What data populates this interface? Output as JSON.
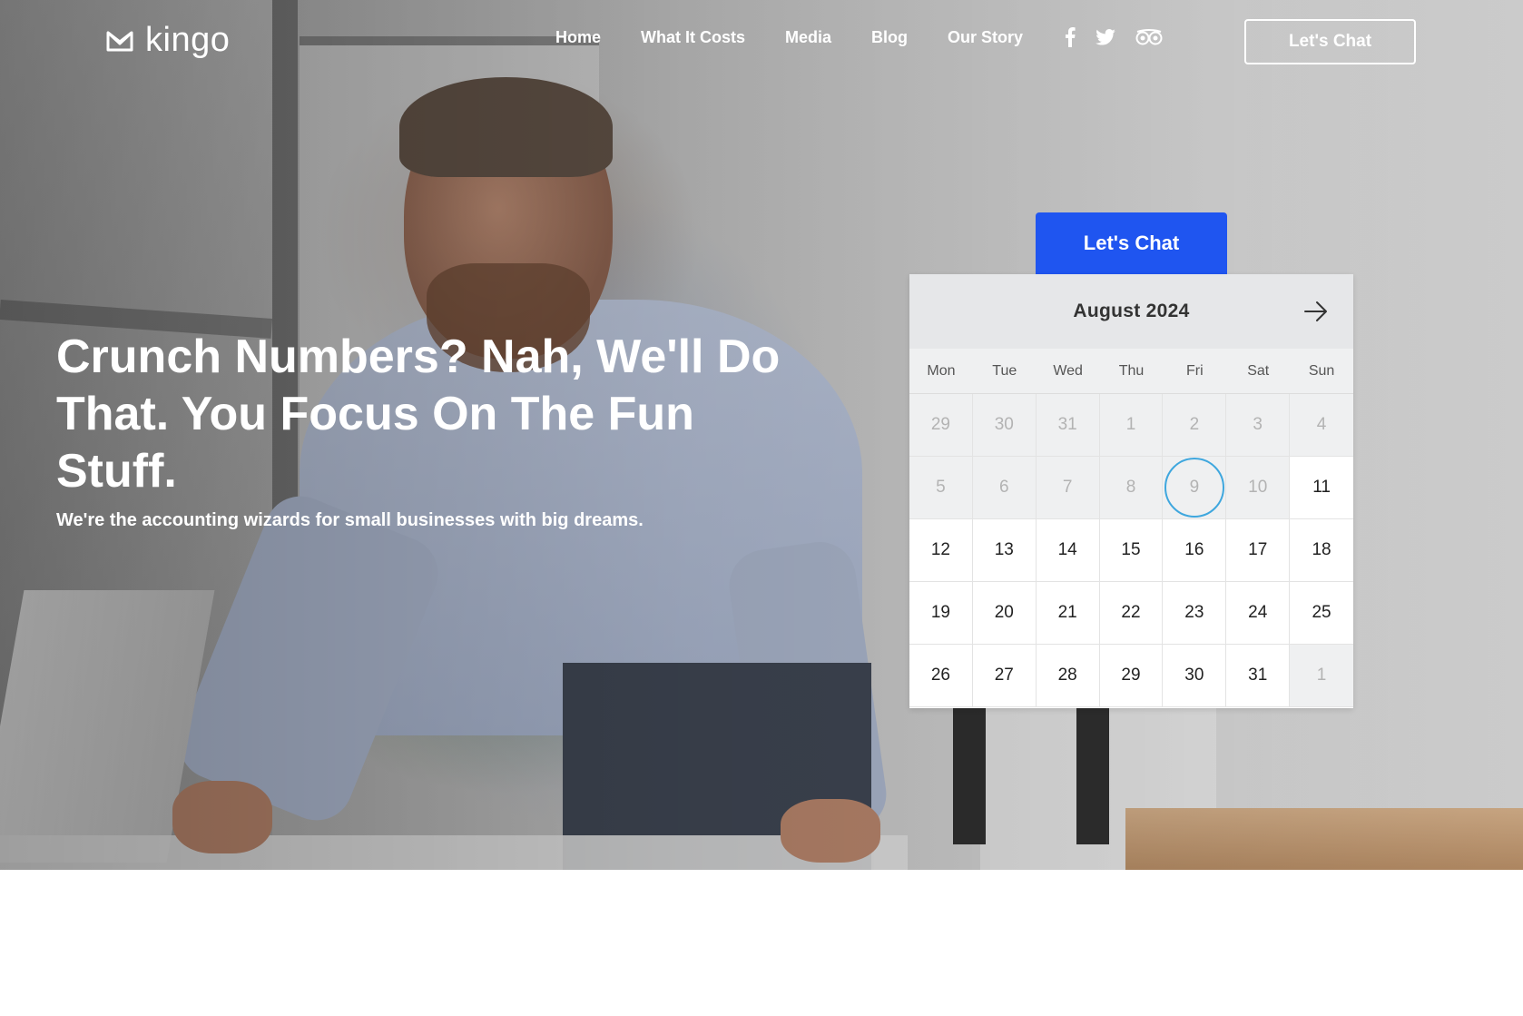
{
  "header": {
    "logo_text": "kingo",
    "nav": [
      "Home",
      "What It Costs",
      "Media",
      "Blog",
      "Our Story"
    ],
    "social_icons": [
      "facebook-icon",
      "twitter-icon",
      "tripadvisor-icon"
    ],
    "cta_label": "Let's Chat"
  },
  "hero": {
    "headline": "Crunch Numbers? Nah, We'll Do That. You Focus On The Fun Stuff.",
    "subline": "We're the accounting wizards for small businesses with big dreams."
  },
  "scheduler": {
    "tab_label": "Let's Chat",
    "month_label": "August 2024",
    "weekdays": [
      "Mon",
      "Tue",
      "Wed",
      "Thu",
      "Fri",
      "Sat",
      "Sun"
    ],
    "days": [
      {
        "label": "29",
        "state": "inactive"
      },
      {
        "label": "30",
        "state": "inactive"
      },
      {
        "label": "31",
        "state": "inactive"
      },
      {
        "label": "1",
        "state": "inactive"
      },
      {
        "label": "2",
        "state": "inactive"
      },
      {
        "label": "3",
        "state": "inactive"
      },
      {
        "label": "4",
        "state": "inactive"
      },
      {
        "label": "5",
        "state": "inactive"
      },
      {
        "label": "6",
        "state": "inactive"
      },
      {
        "label": "7",
        "state": "inactive"
      },
      {
        "label": "8",
        "state": "inactive"
      },
      {
        "label": "9",
        "state": "today"
      },
      {
        "label": "10",
        "state": "inactive"
      },
      {
        "label": "11",
        "state": "available"
      },
      {
        "label": "12",
        "state": "available"
      },
      {
        "label": "13",
        "state": "available"
      },
      {
        "label": "14",
        "state": "available"
      },
      {
        "label": "15",
        "state": "available"
      },
      {
        "label": "16",
        "state": "available"
      },
      {
        "label": "17",
        "state": "available"
      },
      {
        "label": "18",
        "state": "available"
      },
      {
        "label": "19",
        "state": "available"
      },
      {
        "label": "20",
        "state": "available"
      },
      {
        "label": "21",
        "state": "available"
      },
      {
        "label": "22",
        "state": "available"
      },
      {
        "label": "23",
        "state": "available"
      },
      {
        "label": "24",
        "state": "available"
      },
      {
        "label": "25",
        "state": "available"
      },
      {
        "label": "26",
        "state": "available"
      },
      {
        "label": "27",
        "state": "available"
      },
      {
        "label": "28",
        "state": "available"
      },
      {
        "label": "29",
        "state": "available"
      },
      {
        "label": "30",
        "state": "available"
      },
      {
        "label": "31",
        "state": "available"
      },
      {
        "label": "1",
        "state": "inactive"
      }
    ]
  },
  "colors": {
    "primary_blue": "#1f55f0",
    "today_ring": "#3fa7de"
  }
}
